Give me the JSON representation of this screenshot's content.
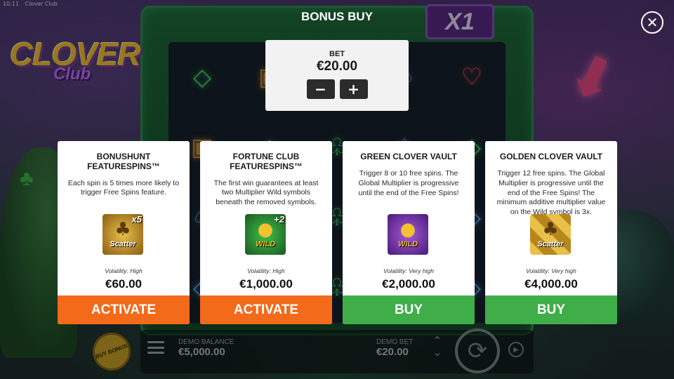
{
  "status_bar": {
    "time": "10:11",
    "app": "Clover Club"
  },
  "logo": {
    "main": "CLOVER",
    "sub": "Club"
  },
  "multiplier": "X1",
  "modal": {
    "title": "BONUS BUY",
    "bet": {
      "label": "BET",
      "value": "€20.00",
      "minus": "−",
      "plus": "+"
    },
    "cards": [
      {
        "title": "BONUSHUNT FEATURESPINS™",
        "description": "Each spin is 5 times more likely to trigger Free Spins feature.",
        "icon": "scatter-clover-icon",
        "icon_word": "Scatter",
        "icon_badge": "x5",
        "volatility": "Volatility: High",
        "price": "€60.00",
        "action": "ACTIVATE",
        "action_color": "#f26a1a"
      },
      {
        "title": "FORTUNE CLUB FEATURESPINS™",
        "description": "The first win guarantees at least two Multiplier Wild symbols beneath the removed symbols.",
        "icon": "wild-pot-green-icon",
        "icon_word": "WILD",
        "icon_badge": "+2",
        "volatility": "Volatility: High",
        "price": "€1,000.00",
        "action": "ACTIVATE",
        "action_color": "#f26a1a"
      },
      {
        "title": "GREEN CLOVER VAULT",
        "description": "Trigger 8 or 10 free spins. The Global Multiplier is progressive until the end of the Free Spins!",
        "icon": "wild-pot-gold-icon",
        "icon_word": "WILD",
        "icon_badge": "",
        "volatility": "Volatility: Very high",
        "price": "€2,000.00",
        "action": "BUY",
        "action_color": "#3fae49"
      },
      {
        "title": "GOLDEN CLOVER VAULT",
        "description": "Trigger 12 free spins. The Global Multiplier is progressive until the end of the Free Spins! The minimum additive multiplier value on the Wild symbol is 3x.",
        "icon": "scatter-stack-icon",
        "icon_word": "Scatter",
        "icon_badge": "",
        "volatility": "Volatility: Very high",
        "price": "€4,000.00",
        "action": "BUY",
        "action_color": "#3fae49"
      }
    ]
  },
  "bottom_bar": {
    "buy_bonus": "BUY BONUS",
    "balance_label": "DEMO BALANCE",
    "balance_value": "€5,000.00",
    "bet_label": "DEMO BET",
    "bet_value": "€20.00"
  }
}
